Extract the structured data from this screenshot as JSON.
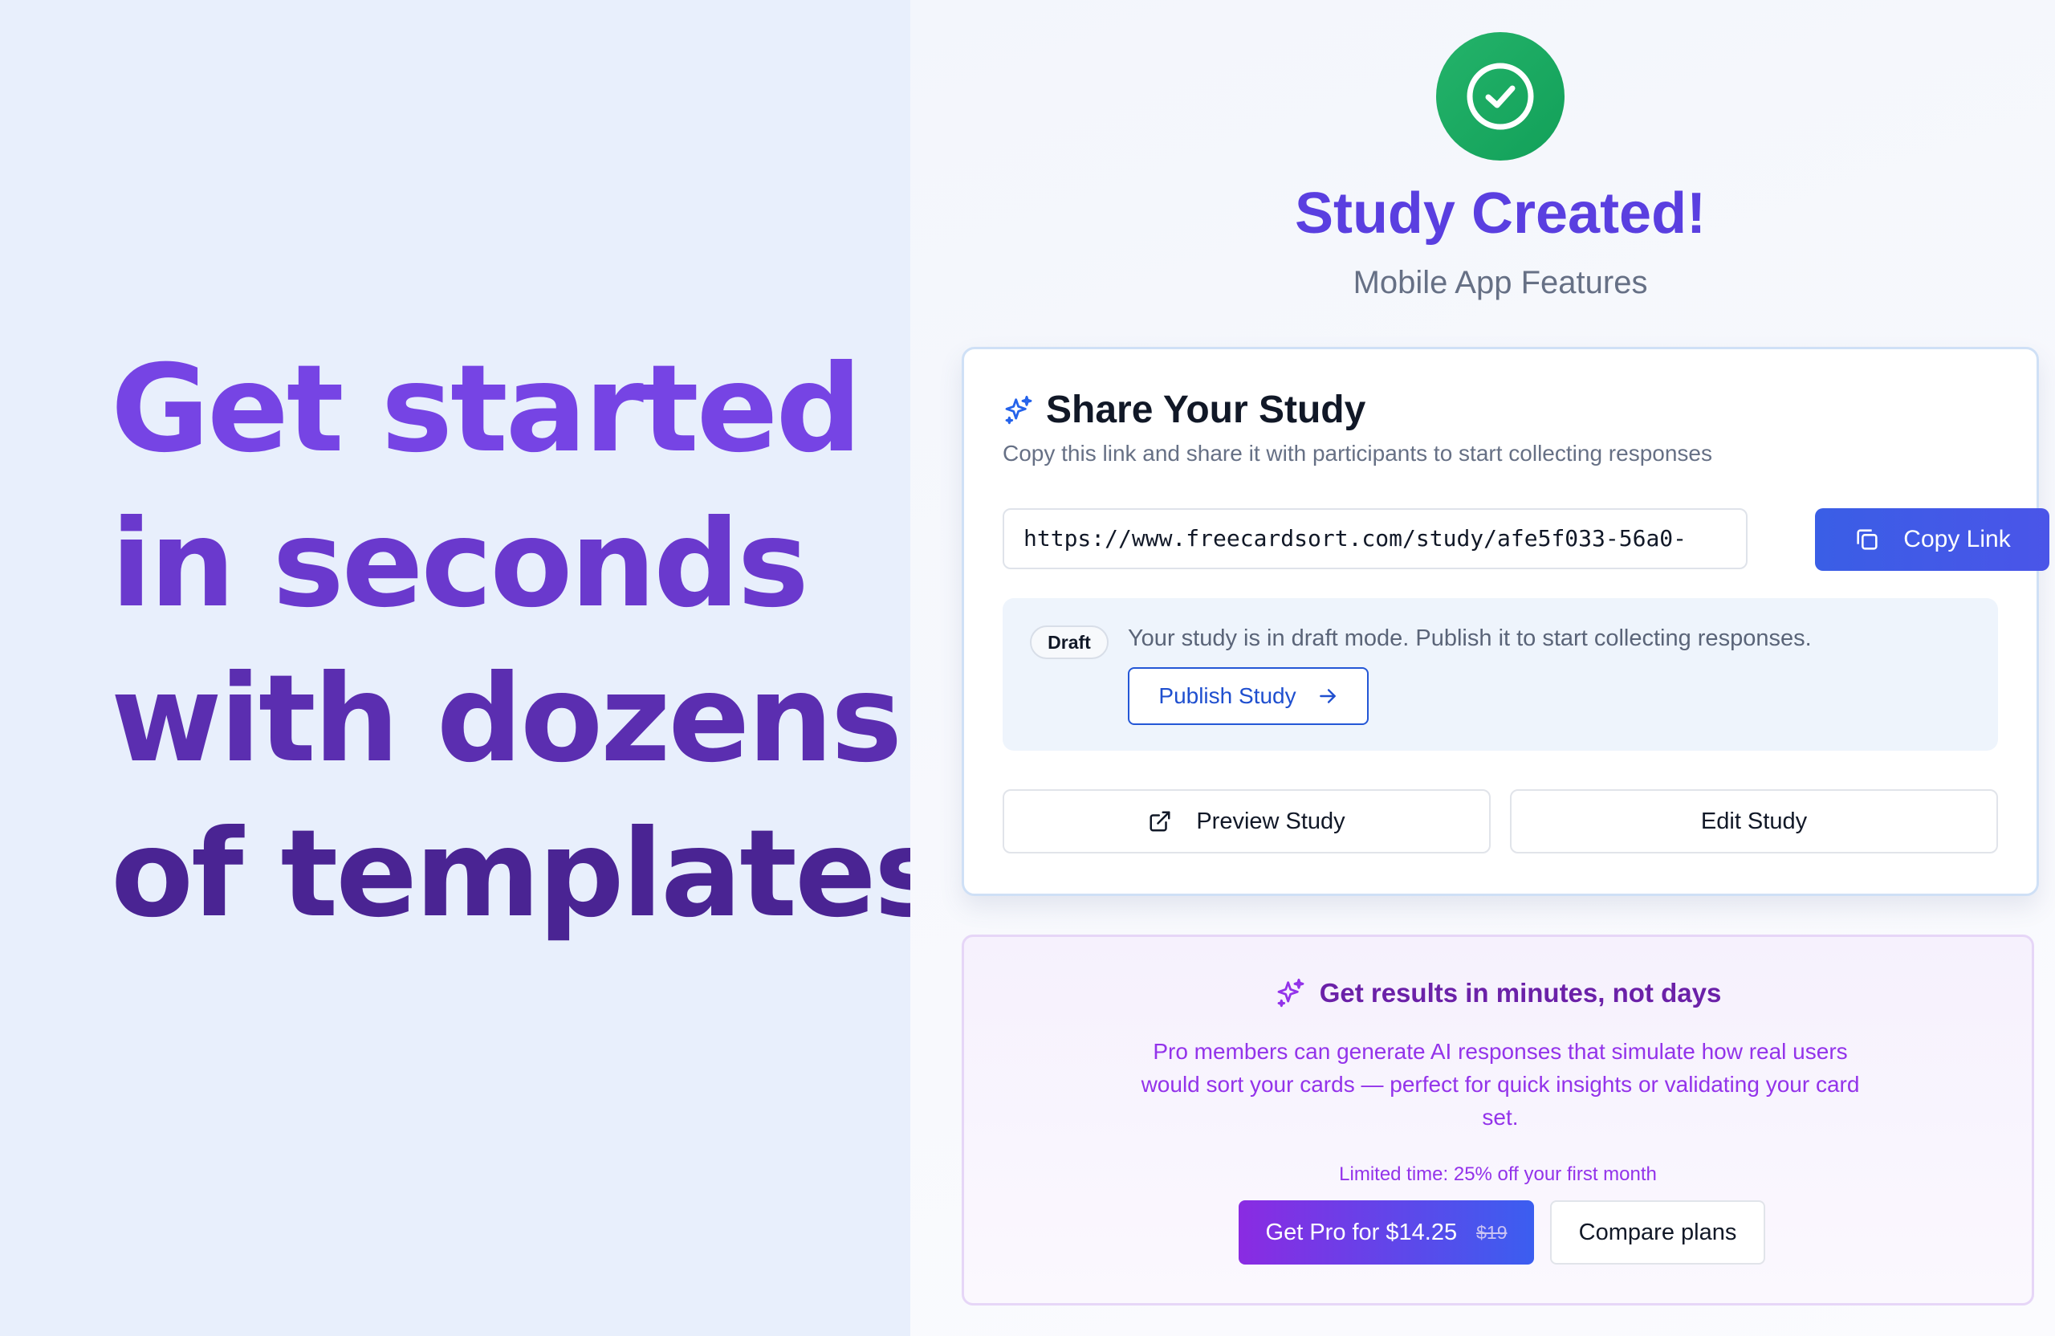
{
  "hero": {
    "lines": [
      "Get started",
      "in seconds",
      "with dozens",
      "of templates"
    ]
  },
  "success": {
    "title": "Study Created!",
    "subtitle": "Mobile App Features",
    "icon": "check-circle-icon",
    "icon_color": "#16a35f"
  },
  "share": {
    "title": "Share Your Study",
    "description": "Copy this link and share it with participants to start collecting responses",
    "url": "https://www.freecardsort.com/study/afe5f033-56a0-",
    "copy_label": "Copy Link",
    "accent": "#3b5ee6"
  },
  "draft": {
    "badge": "Draft",
    "message": "Your study is in draft mode. Publish it to start collecting responses.",
    "publish_label": "Publish Study"
  },
  "actions": {
    "preview_label": "Preview Study",
    "edit_label": "Edit Study"
  },
  "promo": {
    "title": "Get results in minutes, not days",
    "description": "Pro members can generate AI responses that simulate how real users would sort your cards — perfect for quick insights or validating your card set.",
    "limited": "Limited time: 25% off your first month",
    "pro_label": "Get Pro for $14.25",
    "pro_old_price": "$19",
    "compare_label": "Compare plans",
    "accent": "#9333ea"
  }
}
